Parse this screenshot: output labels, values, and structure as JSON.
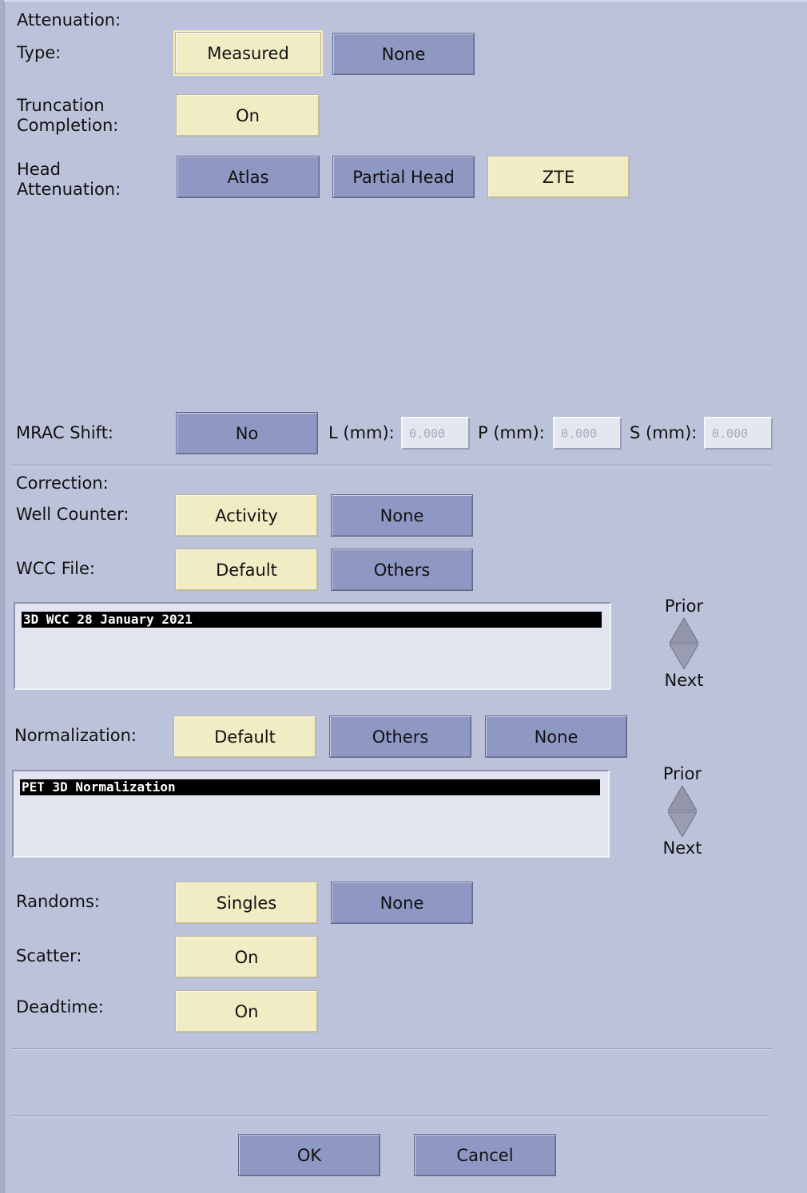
{
  "attenuation": {
    "section_label": "Attenuation:",
    "type_label": "Type:",
    "type_options": [
      "Measured",
      "None"
    ],
    "type_selected": "Measured",
    "truncation_label_line1": "Truncation",
    "truncation_label_line2": "Completion:",
    "truncation_value": "On",
    "head_label_line1": "Head",
    "head_label_line2": "Attenuation:",
    "head_options": [
      "Atlas",
      "Partial Head",
      "ZTE"
    ],
    "head_selected": "ZTE"
  },
  "mrac": {
    "label": "MRAC Shift:",
    "toggle": "No",
    "l_label": "L (mm):",
    "l_value": "0.000",
    "p_label": "P (mm):",
    "p_value": "0.000",
    "s_label": "S (mm):",
    "s_value": "0.000"
  },
  "correction": {
    "section_label": "Correction:",
    "well_counter_label": "Well Counter:",
    "well_counter_options": [
      "Activity",
      "None"
    ],
    "well_counter_selected": "Activity",
    "wcc_file_label": "WCC File:",
    "wcc_file_options": [
      "Default",
      "Others"
    ],
    "wcc_file_selected": "Default",
    "wcc_list": [
      "3D WCC 28 January 2021"
    ],
    "normalization_label": "Normalization:",
    "normalization_options": [
      "Default",
      "Others",
      "None"
    ],
    "normalization_selected": "Default",
    "normalization_list": [
      "PET 3D Normalization"
    ],
    "randoms_label": "Randoms:",
    "randoms_options": [
      "Singles",
      "None"
    ],
    "randoms_selected": "Singles",
    "scatter_label": "Scatter:",
    "scatter_value": "On",
    "deadtime_label": "Deadtime:",
    "deadtime_value": "On"
  },
  "spinner": {
    "prior": "Prior",
    "next": "Next"
  },
  "actions": {
    "ok": "OK",
    "cancel": "Cancel"
  },
  "colors": {
    "background": "#bcc2da",
    "selected": "#f1ecc4",
    "unselected": "#8f98c3"
  }
}
